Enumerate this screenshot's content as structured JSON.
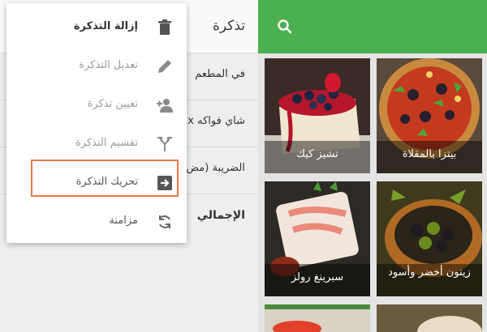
{
  "ticket": {
    "title": "تذكرة",
    "rows": [
      {
        "label": "في المطعم"
      },
      {
        "label": "شاي فواكه x"
      },
      {
        "label": "الضريبة (مض"
      },
      {
        "label": "الإجمالي"
      }
    ]
  },
  "menu": {
    "items": [
      {
        "label": "إزالة التذكرة",
        "icon": "trash-icon"
      },
      {
        "label": "تعديل التذكرة",
        "icon": "pencil-icon"
      },
      {
        "label": "تعيين تذكرة",
        "icon": "person-add-icon"
      },
      {
        "label": "تقسيم التذكرة",
        "icon": "split-icon"
      },
      {
        "label": "تحريك التذكرة",
        "icon": "move-icon"
      },
      {
        "label": "مزامنة",
        "icon": "sync-icon"
      }
    ]
  },
  "products": [
    {
      "name": "تشيز كيك"
    },
    {
      "name": "بيتزا بالمقلاة"
    },
    {
      "name": "سبرينغ رولز"
    },
    {
      "name": "زيتون أخضر وأسود"
    }
  ],
  "colors": {
    "accent": "#4caf50",
    "highlight": "#e8784a"
  }
}
